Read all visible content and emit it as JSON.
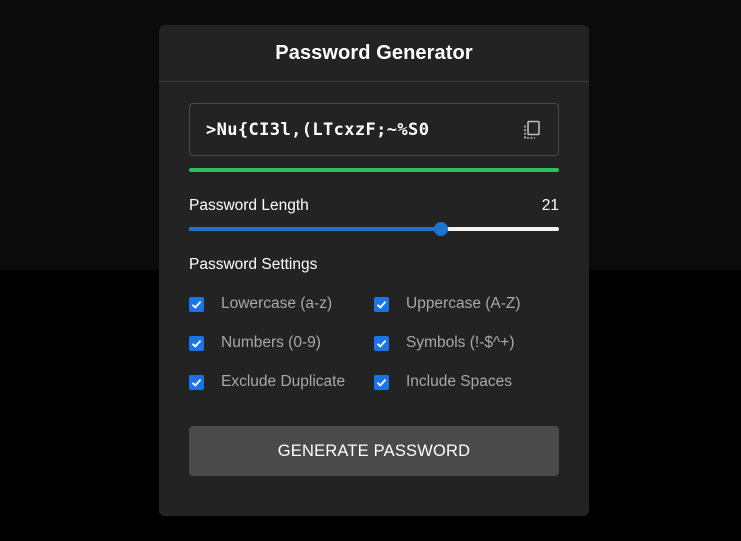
{
  "app": {
    "title": "Password Generator"
  },
  "password": {
    "value": ">Nu{CI3l,(LTcxzF;~%S0",
    "copy_icon": "copy-icon",
    "strength_color": "#2bbf64"
  },
  "length": {
    "label": "Password Length",
    "value": "21",
    "fill_fraction": 0.68,
    "accent": "#1b74d0"
  },
  "settings": {
    "title": "Password Settings",
    "options": [
      {
        "label": "Lowercase (a-z)",
        "checked": true
      },
      {
        "label": "Uppercase (A-Z)",
        "checked": true
      },
      {
        "label": "Numbers (0-9)",
        "checked": true
      },
      {
        "label": "Symbols (!-$^+)",
        "checked": true
      },
      {
        "label": "Exclude Duplicate",
        "checked": true
      },
      {
        "label": "Include Spaces",
        "checked": true
      }
    ]
  },
  "actions": {
    "generate_label": "GENERATE PASSWORD"
  }
}
